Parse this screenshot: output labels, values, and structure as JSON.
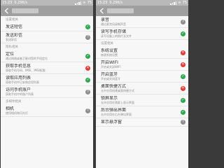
{
  "left": {
    "status": {
      "time": "15:23",
      "speed": "0.29K/s",
      "battery": "75"
    },
    "title": "某某权限",
    "sections": [
      {
        "header": "设置相关",
        "rows": [
          {
            "title": "发送短信",
            "subtitle": "",
            "state": "allow"
          },
          {
            "title": "发送彩信",
            "subtitle": "发送彩信",
            "state": "ask"
          }
        ]
      },
      {
        "header": "隐私相关",
        "rows": [
          {
            "title": "定位",
            "subtitle": "通过网络或者卫星对您的手机定位",
            "state": "allow"
          },
          {
            "title": "获取手机信息",
            "subtitle": "获取手机号码、IMEI、IMSI权限",
            "state": "deny"
          },
          {
            "title": "读取应用列表",
            "subtitle": "获取手机中已安装应用列表",
            "state": "allow"
          },
          {
            "title": "访问手机账户",
            "subtitle": "获取手机中的账户列表",
            "state": "ask"
          }
        ]
      },
      {
        "header": "多媒体相关",
        "rows": [
          {
            "title": "相机",
            "subtitle": "使用相机和闪光灯",
            "state": "ask"
          }
        ]
      }
    ]
  },
  "right": {
    "status": {
      "time": "15:23",
      "speed": "0.29K/s",
      "battery": "75"
    },
    "title": "某某权限",
    "sections": [
      {
        "header": "",
        "rows": [
          {
            "title": "录音",
            "subtitle": "通过麦克风录制声音",
            "state": "ask"
          },
          {
            "title": "读写手机存储",
            "subtitle": "读写设备上的照片及文件",
            "state": "allow"
          }
        ]
      },
      {
        "header": "设置相关",
        "rows": [
          {
            "title": "系统设置",
            "subtitle": "修改系统设置",
            "state": "deny"
          },
          {
            "title": "开启WIFI",
            "subtitle": "开启或关闭WIFI",
            "state": "deny"
          },
          {
            "title": "开启蓝牙",
            "subtitle": "开启或关闭蓝牙",
            "state": "allow"
          },
          {
            "title": "桌面快捷方式",
            "subtitle": "允许应用创建桌面快捷方式",
            "state": "deny"
          },
          {
            "title": "锁屏显示",
            "subtitle": "允许应用在锁屏上显示界面",
            "state": "allow"
          },
          {
            "title": "后台弹出界面",
            "subtitle": "允许应用在后台弹出界面",
            "state": "allow"
          },
          {
            "title": "显示悬浮窗",
            "subtitle": "",
            "state": "ask"
          }
        ]
      }
    ]
  },
  "colors": {
    "allow": "#2fa84f",
    "deny": "#e53935",
    "ask": "#8e8e8e"
  },
  "icons": {
    "allow": "check-icon",
    "deny": "cross-icon",
    "ask": "question-icon"
  }
}
